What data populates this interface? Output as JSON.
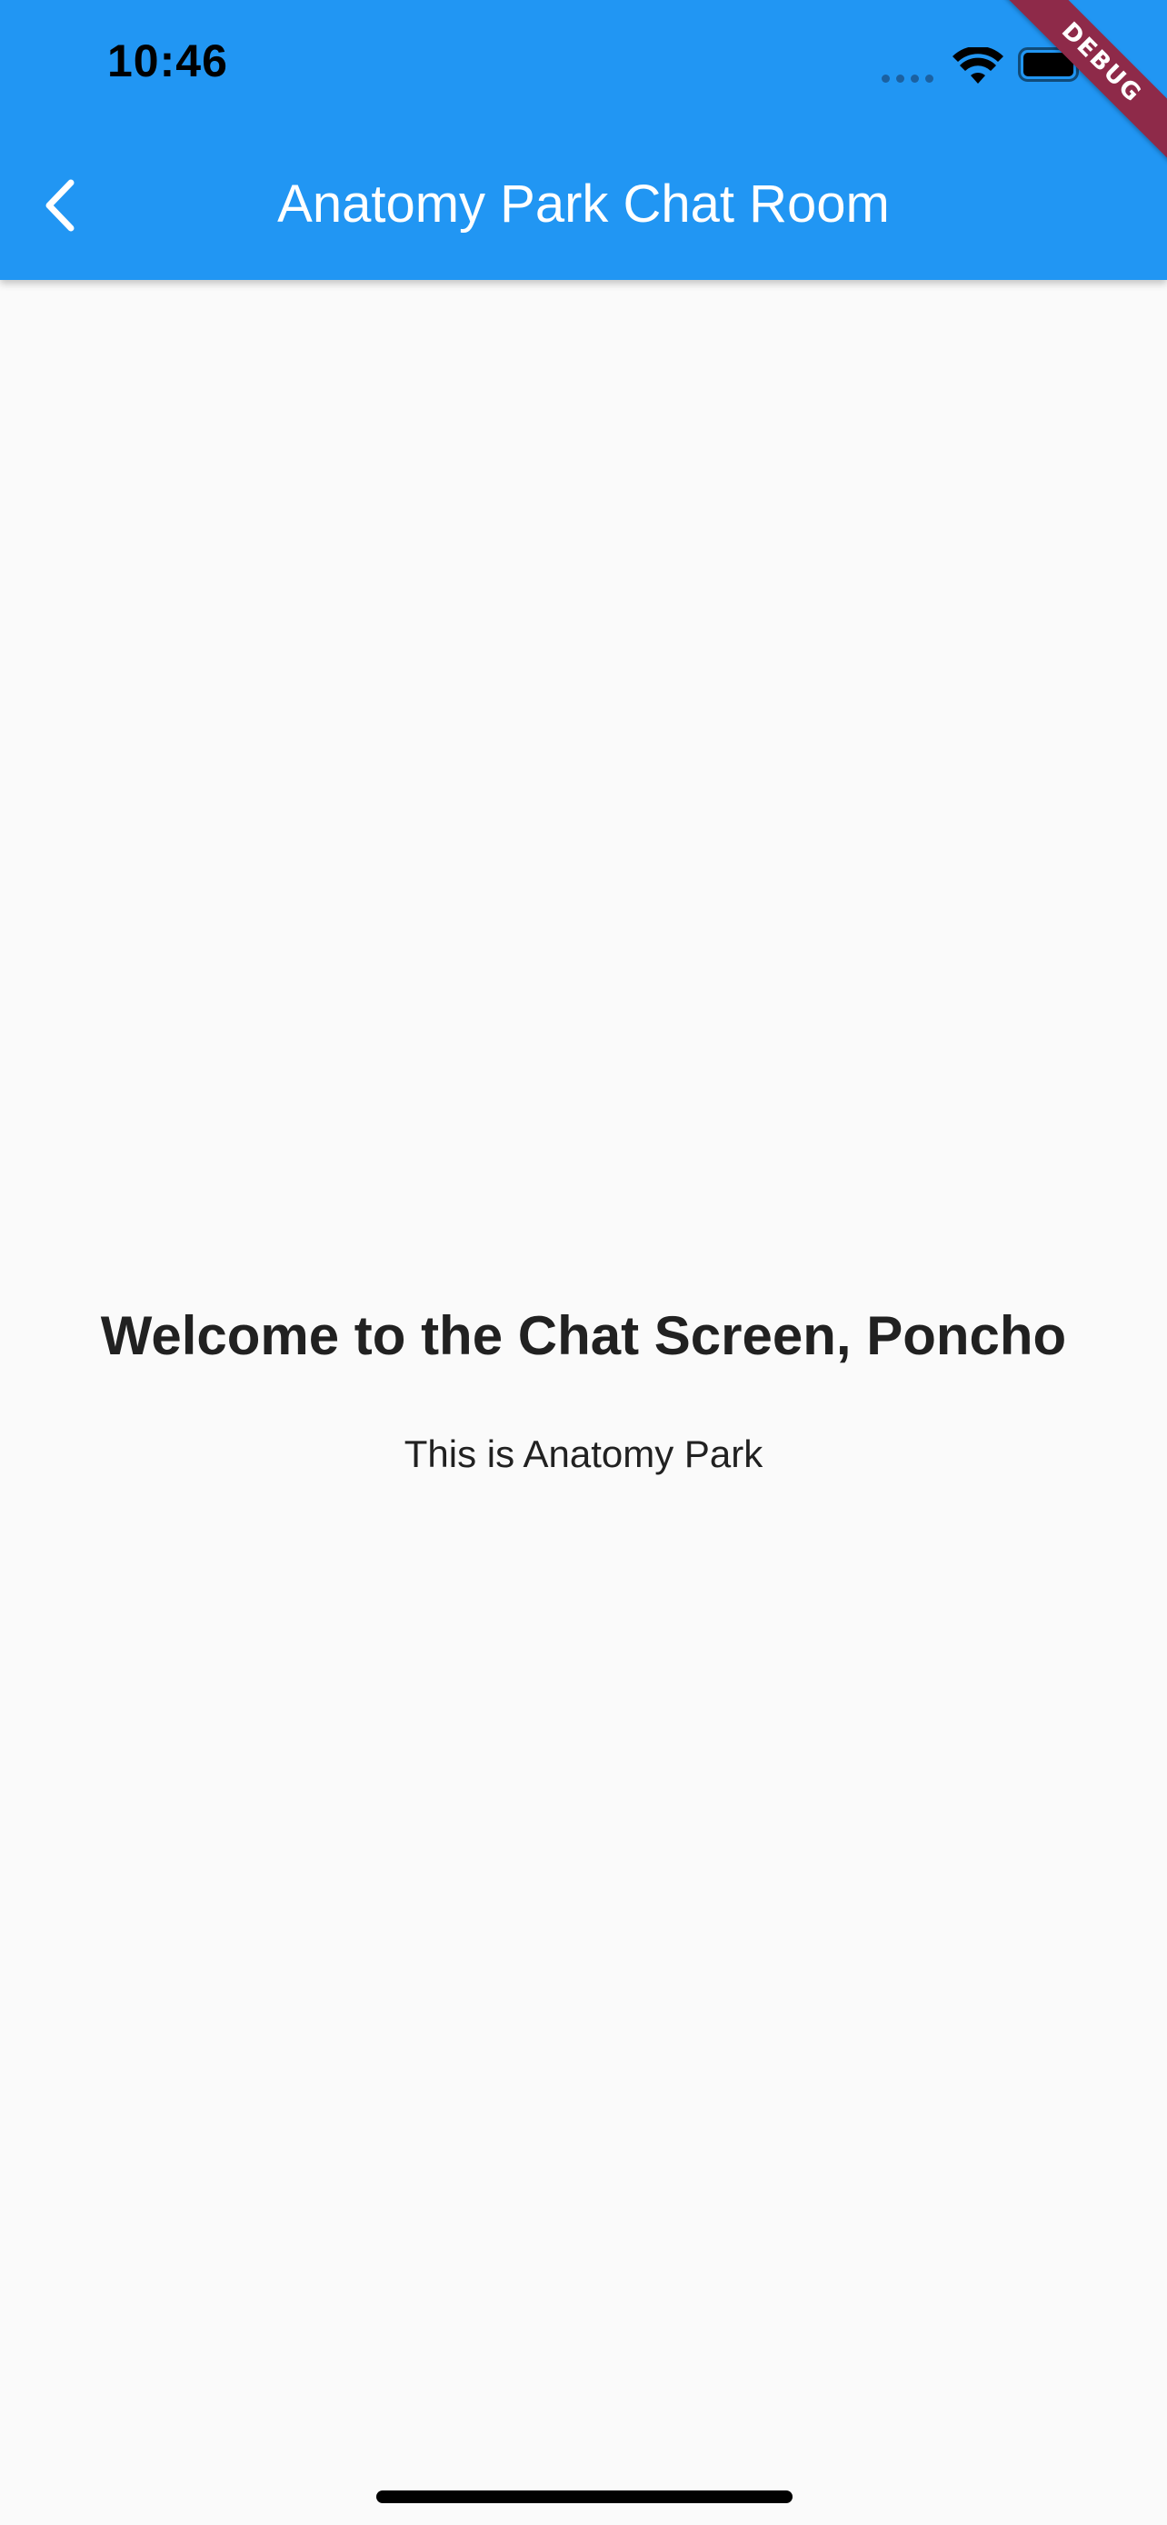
{
  "status_bar": {
    "time": "10:46"
  },
  "appbar": {
    "title": "Anatomy Park Chat Room",
    "back_icon": "chevron-left-icon",
    "background_color": "#2196F3"
  },
  "debug_banner": {
    "label": "DEBUG",
    "color": "#8E2A49"
  },
  "main": {
    "welcome_text": "Welcome to the Chat Screen, Poncho",
    "subtitle_text": "This is Anatomy Park"
  }
}
